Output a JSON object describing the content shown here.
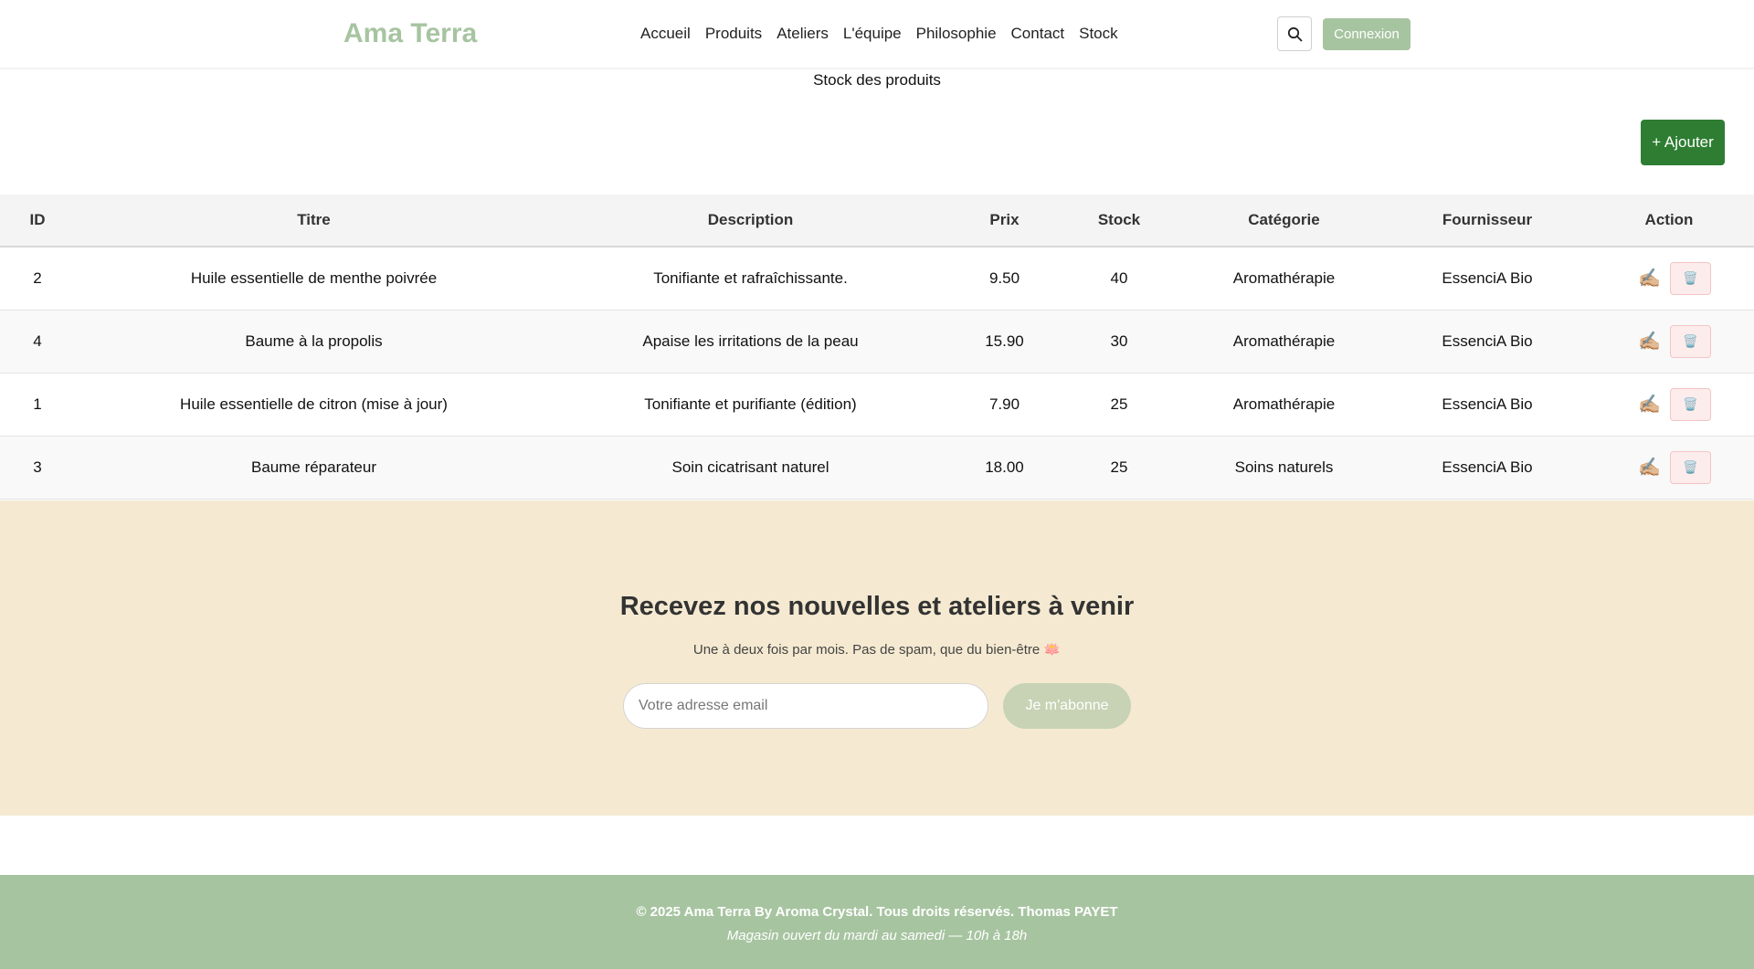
{
  "header": {
    "logo": "Ama Terra",
    "nav": [
      "Accueil",
      "Produits",
      "Ateliers",
      "L'équipe",
      "Philosophie",
      "Contact",
      "Stock"
    ],
    "login_label": "Connexion"
  },
  "main": {
    "title": "Stock des produits",
    "add_label": "+ Ajouter"
  },
  "table": {
    "headers": [
      "ID",
      "Titre",
      "Description",
      "Prix",
      "Stock",
      "Catégorie",
      "Fournisseur",
      "Action"
    ],
    "rows": [
      {
        "id": "2",
        "title": "Huile essentielle de menthe poivrée",
        "description": "Tonifiante et rafraîchissante.",
        "price": "9.50",
        "stock": "40",
        "category": "Aromathérapie",
        "supplier": "EssenciA Bio"
      },
      {
        "id": "4",
        "title": "Baume à la propolis",
        "description": "Apaise les irritations de la peau",
        "price": "15.90",
        "stock": "30",
        "category": "Aromathérapie",
        "supplier": "EssenciA Bio"
      },
      {
        "id": "1",
        "title": "Huile essentielle de citron (mise à jour)",
        "description": "Tonifiante et purifiante (édition)",
        "price": "7.90",
        "stock": "25",
        "category": "Aromathérapie",
        "supplier": "EssenciA Bio"
      },
      {
        "id": "3",
        "title": "Baume réparateur",
        "description": "Soin cicatrisant naturel",
        "price": "18.00",
        "stock": "25",
        "category": "Soins naturels",
        "supplier": "EssenciA Bio"
      }
    ],
    "edit_icon": "✍🏼",
    "delete_icon": "🗑️"
  },
  "newsletter": {
    "title": "Recevez nos nouvelles et ateliers à venir",
    "subtitle": "Une à deux fois par mois. Pas de spam, que du bien-être 🪷",
    "placeholder": "Votre adresse email",
    "button_label": "Je m'abonne"
  },
  "footer": {
    "copyright": "© 2025 Ama Terra By Aroma Crystal. Tous droits réservés. Thomas PAYET",
    "hours": "Magasin ouvert du mardi au samedi — 10h à 18h"
  },
  "colors": {
    "brand": "#a7c4a0",
    "add_button": "#2e7d32",
    "newsletter_bg": "#f5ead1"
  }
}
